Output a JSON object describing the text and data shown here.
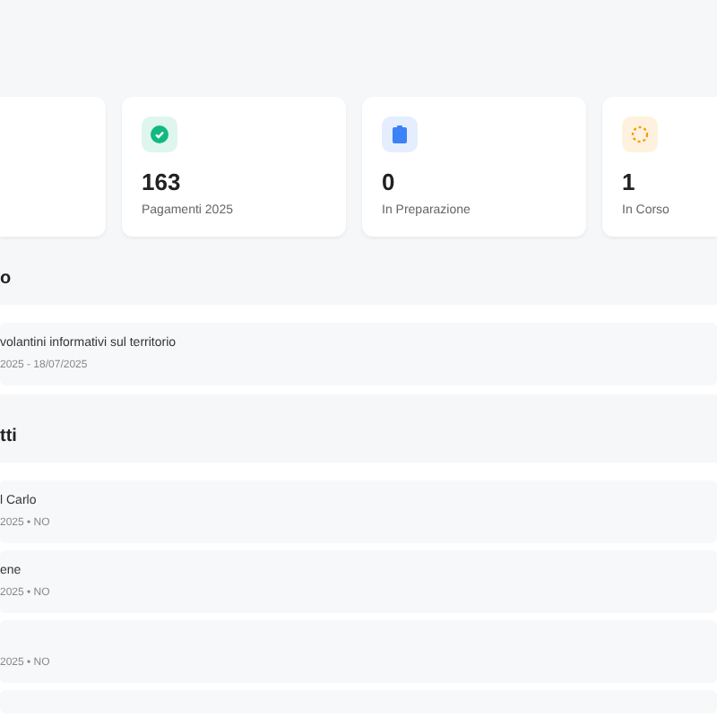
{
  "stats": [
    {
      "kind": "blank"
    },
    {
      "kind": "check",
      "color": "#10b981",
      "value": "163",
      "label": "Pagamenti 2025"
    },
    {
      "kind": "clipboard",
      "color": "#3b82f6",
      "value": "0",
      "label": "In Preparazione"
    },
    {
      "kind": "spinner",
      "color": "#f59e0b",
      "value": "1",
      "label": "In Corso"
    }
  ],
  "sections": [
    {
      "title": "o",
      "items": [
        {
          "title": "volantini informativi sul territorio",
          "meta": "2025 - 18/07/2025"
        }
      ]
    },
    {
      "title": "tti",
      "items": [
        {
          "title": "l Carlo",
          "meta": "2025 • NO"
        },
        {
          "title": "ene",
          "meta": "2025 • NO"
        },
        {
          "meta": "2025 • NO"
        },
        {
          "kind": "cut"
        }
      ]
    }
  ]
}
